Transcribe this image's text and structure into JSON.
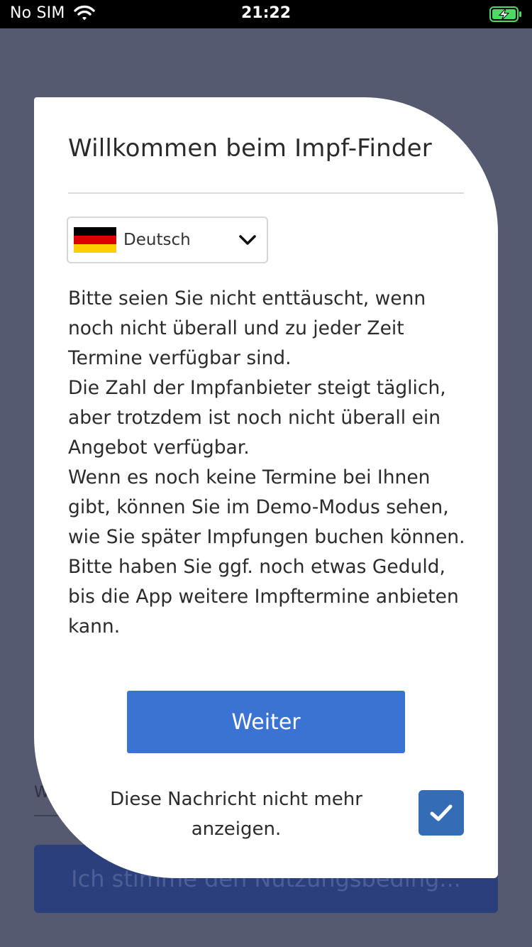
{
  "status_bar": {
    "carrier": "No SIM",
    "time": "21:22"
  },
  "background": {
    "field_text": "W",
    "button_label": "Ich stimme den Nutzungsbeding..."
  },
  "dialog": {
    "title": "Willkommen beim Impf-Finder",
    "language": {
      "selected": "Deutsch",
      "flag": "german-flag-icon"
    },
    "body_lines": [
      "Bitte seien Sie nicht enttäuscht, wenn",
      "noch nicht überall und zu jeder Zeit",
      "Termine verfügbar sind.",
      "Die Zahl der Impfanbieter steigt täglich,",
      "aber trotzdem ist noch nicht überall ein",
      "Angebot verfügbar.",
      "Wenn es noch keine Termine bei Ihnen",
      "gibt, können Sie im Demo-Modus sehen,",
      "wie Sie später Impfungen buchen können.",
      "Bitte haben Sie ggf. noch etwas Geduld,",
      "bis die App weitere Impftermine anbieten",
      "kann."
    ],
    "continue_label": "Weiter",
    "dont_show_line1": "Diese Nachricht nicht mehr",
    "dont_show_line2": "anzeigen.",
    "dont_show_checked": true
  },
  "colors": {
    "overlay": "#565a70",
    "primary": "#3b73d3",
    "checkbox": "#356cb6",
    "battery_charging": "#4cd964"
  }
}
